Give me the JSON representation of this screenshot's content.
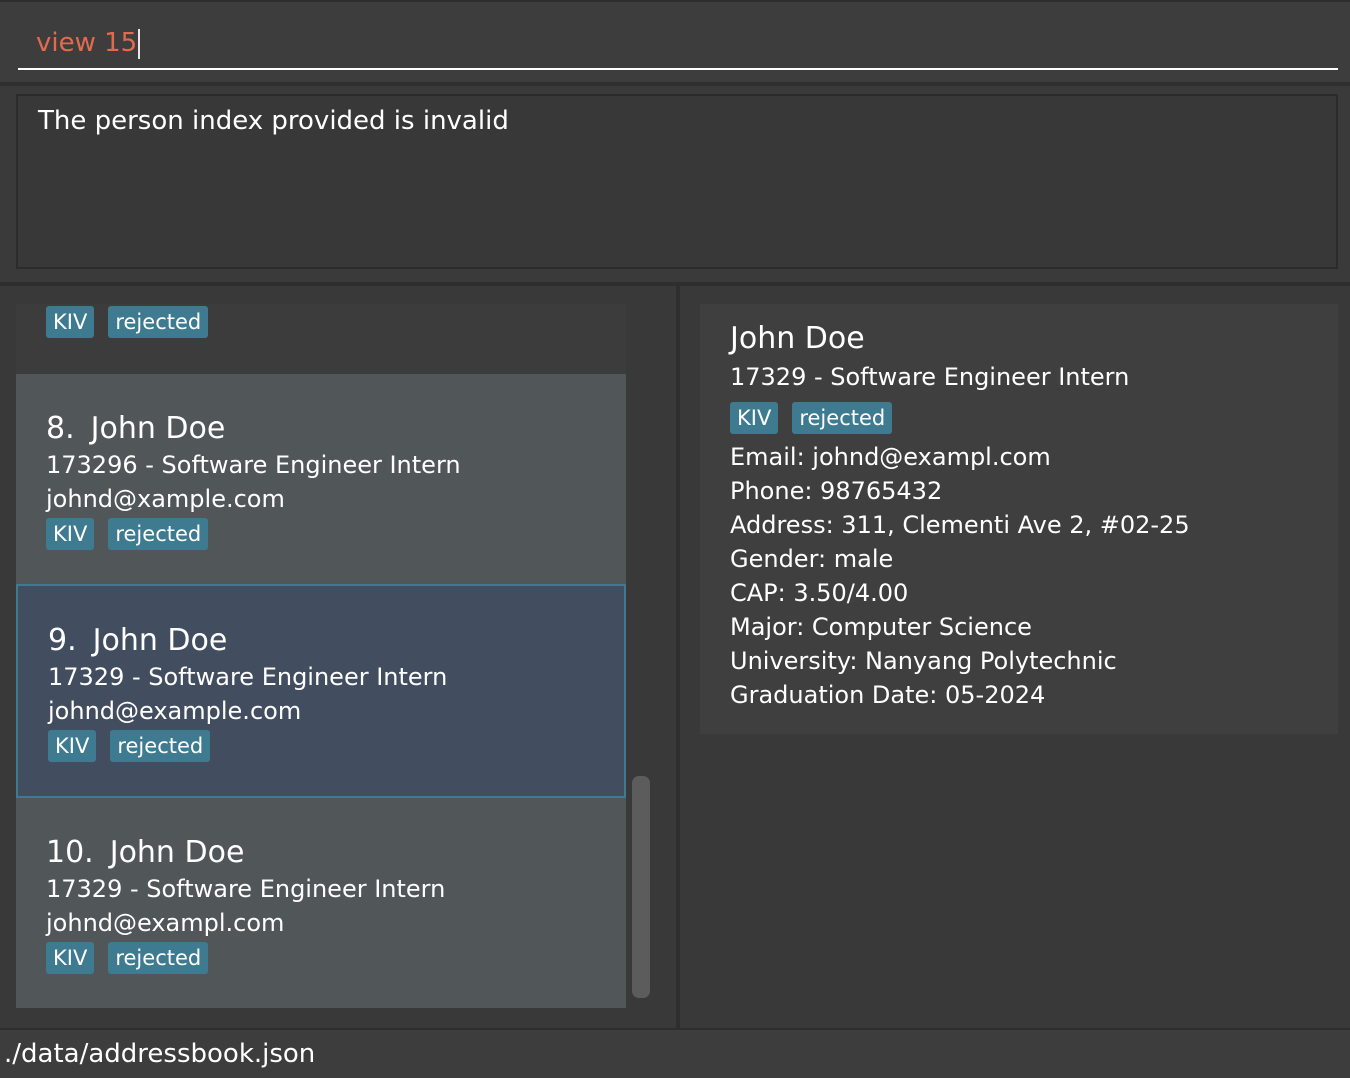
{
  "command": {
    "value": "view 15"
  },
  "result": {
    "message": "The person index provided is invalid"
  },
  "list": {
    "partial_card": {
      "tags": [
        "KIV",
        "rejected"
      ]
    },
    "cards": [
      {
        "index": "8.",
        "name": "John Doe",
        "job": "173296 - Software Engineer Intern",
        "email": "johnd@xample.com",
        "tags": [
          "KIV",
          "rejected"
        ]
      },
      {
        "index": "9.",
        "name": "John Doe",
        "job": "17329 - Software Engineer Intern",
        "email": "johnd@example.com",
        "tags": [
          "KIV",
          "rejected"
        ]
      },
      {
        "index": "10.",
        "name": "John Doe",
        "job": "17329 - Software Engineer Intern",
        "email": "johnd@exampl.com",
        "tags": [
          "KIV",
          "rejected"
        ]
      }
    ]
  },
  "detail": {
    "name": "John Doe",
    "job": "17329 - Software Engineer Intern",
    "tags": [
      "KIV",
      "rejected"
    ],
    "email": "Email: johnd@exampl.com",
    "phone": "Phone: 98765432",
    "address": "Address: 311, Clementi Ave 2, #02-25",
    "gender": "Gender: male",
    "cap": "CAP: 3.50/4.00",
    "major": "Major: Computer Science",
    "university": "University: Nanyang Polytechnic",
    "graduation": "Graduation Date: 05-2024"
  },
  "status": {
    "path": "./data/addressbook.json"
  },
  "colors": {
    "accent": "#3e7b91",
    "command_text": "#e26a4f",
    "selected_bg": "#424d5f"
  }
}
